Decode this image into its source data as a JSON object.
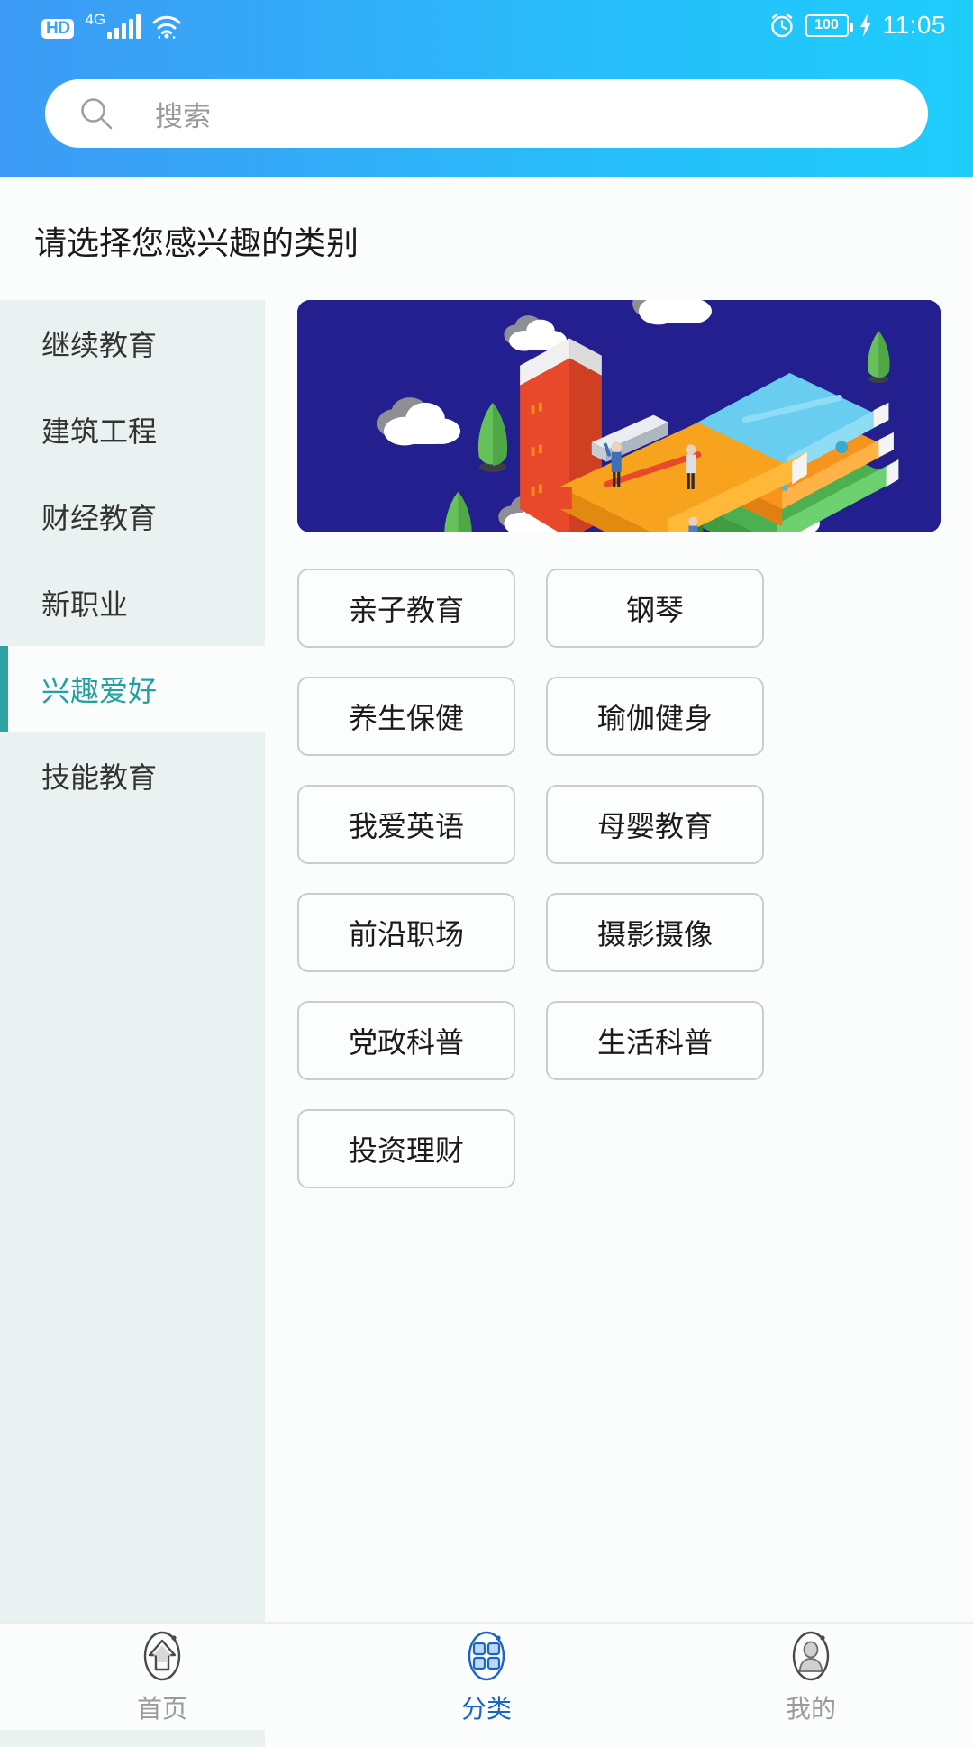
{
  "status_bar": {
    "hd_badge": "HD",
    "network_type": "4G",
    "signal_icon": "signal-bars-icon",
    "wifi_icon": "wifi-icon",
    "alarm_icon": "alarm-clock-icon",
    "battery_level": "100",
    "charging_icon": "charging-bolt-icon",
    "time": "11:05"
  },
  "header": {
    "search_icon": "search-icon",
    "search_placeholder": "搜索",
    "search_value": "",
    "gradient_start": "#3d9bf5",
    "gradient_end": "#1ecdfb"
  },
  "page": {
    "title": "请选择您感兴趣的类别",
    "accent_color": "#2ea3a3",
    "background": "#fbfcfc"
  },
  "sidebar": {
    "background": "#e9f2f0",
    "active_index": 4,
    "items": [
      {
        "label": "继续教育"
      },
      {
        "label": "建筑工程"
      },
      {
        "label": "财经教育"
      },
      {
        "label": "新职业"
      },
      {
        "label": "兴趣爱好"
      },
      {
        "label": "技能教育"
      }
    ]
  },
  "banner": {
    "name": "books-illustration-banner",
    "background": "#231f8f",
    "alt": "等距插画：堆叠的书本、云朵、树木和人物"
  },
  "categories": {
    "items": [
      {
        "label": "亲子教育"
      },
      {
        "label": "钢琴"
      },
      {
        "label": "养生保健"
      },
      {
        "label": "瑜伽健身"
      },
      {
        "label": "我爱英语"
      },
      {
        "label": "母婴教育"
      },
      {
        "label": "前沿职场"
      },
      {
        "label": "摄影摄像"
      },
      {
        "label": "党政科普"
      },
      {
        "label": "生活科普"
      },
      {
        "label": "投资理财"
      }
    ]
  },
  "bottom_nav": {
    "active_index": 1,
    "active_color": "#1b64c4",
    "inactive_color": "#9b9b9b",
    "items": [
      {
        "label": "首页",
        "icon": "home-icon"
      },
      {
        "label": "分类",
        "icon": "grid-category-icon"
      },
      {
        "label": "我的",
        "icon": "person-profile-icon"
      }
    ]
  }
}
